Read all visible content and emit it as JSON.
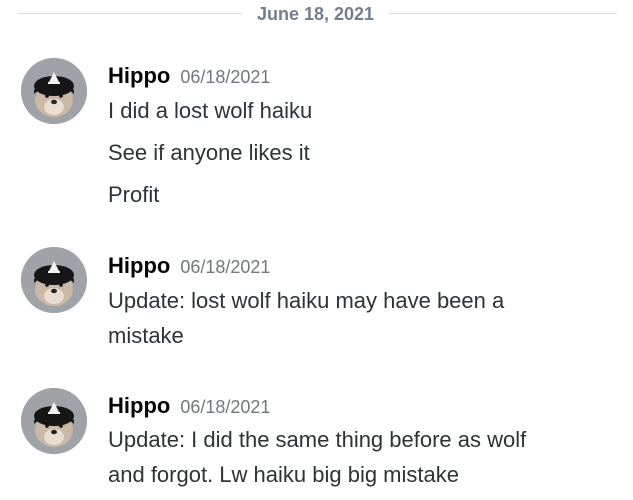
{
  "date_divider": "June 18, 2021",
  "messages": [
    {
      "author": "Hippo",
      "timestamp": "06/18/2021",
      "lines": [
        "I did a lost wolf haiku",
        "See if anyone likes it",
        "Profit"
      ]
    },
    {
      "author": "Hippo",
      "timestamp": "06/18/2021",
      "lines": [
        "Update: lost wolf haiku may have been a",
        "mistake"
      ]
    },
    {
      "author": "Hippo",
      "timestamp": "06/18/2021",
      "lines": [
        "Update: I did the same thing before as wolf",
        "and forgot. Lw haiku big big mistake"
      ]
    }
  ],
  "avatar_icon": "dog-with-hat-avatar-icon"
}
